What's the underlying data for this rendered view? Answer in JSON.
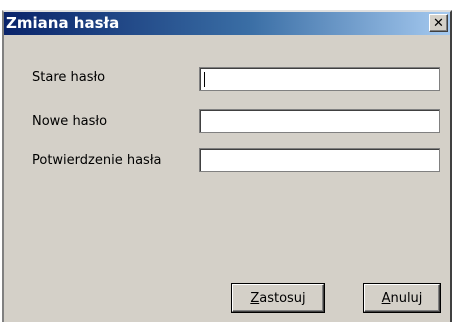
{
  "window": {
    "title": "Zmiana hasła",
    "close_glyph": "✕"
  },
  "form": {
    "old_password_label": "Stare hasło",
    "new_password_label": "Nowe hasło",
    "confirm_password_label": "Potwierdzenie hasła",
    "old_password_value": "",
    "new_password_value": "",
    "confirm_password_value": ""
  },
  "buttons": {
    "apply_mnemonic": "Z",
    "apply_rest": "astosuj",
    "cancel_mnemonic": "A",
    "cancel_rest": "nuluj"
  },
  "colors": {
    "titlebar_start": "#0a246a",
    "titlebar_end": "#a6caf0",
    "face": "#d4d0c8"
  }
}
